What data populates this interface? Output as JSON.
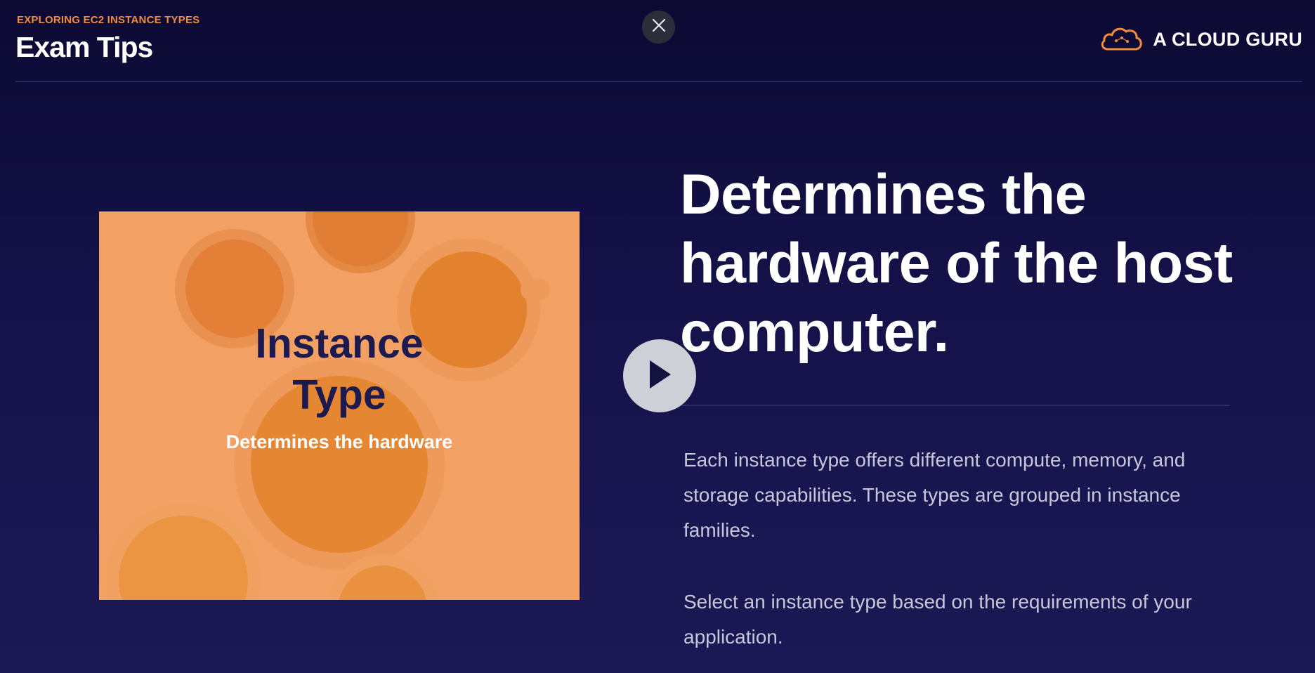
{
  "header": {
    "eyebrow": "EXPLORING EC2 INSTANCE TYPES",
    "title": "Exam Tips",
    "close_icon": "close-icon",
    "brand": {
      "name": "A CLOUD GURU",
      "logo_icon": "cloud-logo-icon"
    }
  },
  "thumbnail": {
    "title_line1": "Instance",
    "title_line2": "Type",
    "subtitle": "Determines the hardware",
    "background_color": "#f3a064"
  },
  "player": {
    "play_icon": "play-icon"
  },
  "main": {
    "headline": "Determines the hardware of the host computer.",
    "paragraphs": [
      "Each instance type offers different compute, memory, and storage capabilities. These types are grouped in instance families.",
      "Select an instance type based on the requirements of your application."
    ]
  },
  "colors": {
    "accent": "#f28b3a",
    "background": "#15124a",
    "body_text": "#c7c7d9"
  }
}
